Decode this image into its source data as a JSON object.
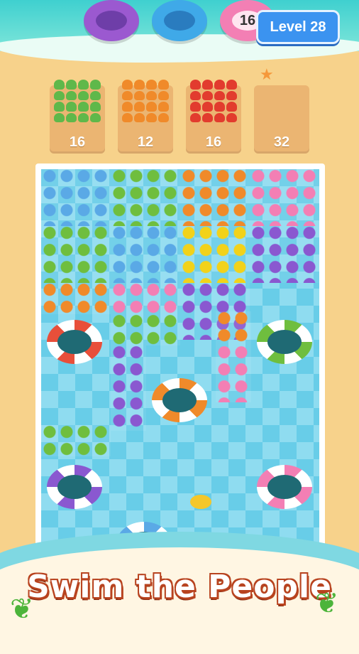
{
  "header": {
    "level_label": "Level 28",
    "rings": [
      {
        "color": "#9b59d0",
        "count": ""
      },
      {
        "color": "#3fa9e8",
        "count": ""
      },
      {
        "color": "#f37fb4",
        "count": "16"
      }
    ]
  },
  "slots": [
    {
      "color": "#5fb84a",
      "count": "16"
    },
    {
      "color": "#f08a2a",
      "count": "12"
    },
    {
      "color": "#e23b2e",
      "count": "16"
    },
    {
      "color": "",
      "count": "32"
    }
  ],
  "board": {
    "blocks": [
      {
        "color": "#5aa9e6"
      },
      {
        "color": "#6fbe3e"
      },
      {
        "color": "#f08a2a"
      },
      {
        "color": "#f37fb4"
      },
      {
        "color": "#6fbe3e"
      },
      {
        "color": "#5aa9e6"
      },
      {
        "color": "#f2d21a"
      },
      {
        "color": "#8a58d0"
      },
      {
        "color": "#f08a2a"
      },
      {
        "color": "#f37fb4"
      },
      {
        "color": "#8a58d0"
      },
      {
        "color": "#6fbe3e"
      },
      {
        "color": "#8a58d0"
      },
      {
        "color": "#f37fb4"
      },
      {
        "color": "#f08a2a"
      },
      {
        "color": "#6fbe3e"
      }
    ],
    "floats": [
      {
        "color": "#e84f3a"
      },
      {
        "color": "#6fbe3e"
      },
      {
        "color": "#f08a2a"
      },
      {
        "color": "#8a58d0"
      },
      {
        "color": "#f37fb4"
      },
      {
        "color": "#5aa9e6"
      }
    ]
  },
  "banner": {
    "caption": "Swim the People"
  }
}
